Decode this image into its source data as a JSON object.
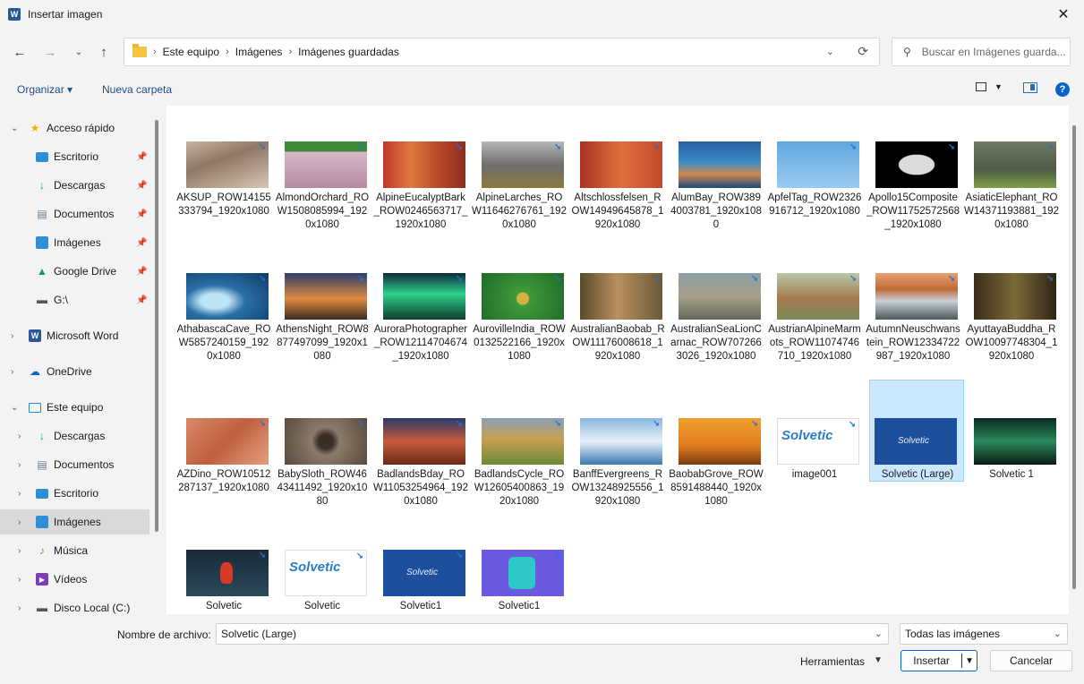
{
  "window": {
    "title": "Insertar imagen",
    "app_icon": "W"
  },
  "address": {
    "crumbs": [
      "Este equipo",
      "Imágenes",
      "Imágenes guardadas"
    ],
    "search_placeholder": "Buscar en Imágenes guarda..."
  },
  "toolbar": {
    "organize": "Organizar ▾",
    "new_folder": "Nueva carpeta"
  },
  "sidebar": {
    "items": [
      {
        "label": "Acceso rápido"
      },
      {
        "label": "Escritorio"
      },
      {
        "label": "Descargas"
      },
      {
        "label": "Documentos"
      },
      {
        "label": "Imágenes"
      },
      {
        "label": "Google Drive"
      },
      {
        "label": "G:\\"
      },
      {
        "label": "Microsoft Word"
      },
      {
        "label": "OneDrive"
      },
      {
        "label": "Este equipo"
      },
      {
        "label": "Descargas"
      },
      {
        "label": "Documentos"
      },
      {
        "label": "Escritorio"
      },
      {
        "label": "Imágenes"
      },
      {
        "label": "Música"
      },
      {
        "label": "Vídeos"
      },
      {
        "label": "Disco Local (C:)"
      }
    ]
  },
  "files": [
    {
      "name": "AKSUP_ROW14155333794_1920x1080"
    },
    {
      "name": "AlmondOrchard_ROW1508085994_1920x1080"
    },
    {
      "name": "AlpineEucalyptBark_ROW0246563717_1920x1080"
    },
    {
      "name": "AlpineLarches_ROW11646276761_1920x1080"
    },
    {
      "name": "Altschlossfelsen_ROW14949645878_1920x1080"
    },
    {
      "name": "AlumBay_ROW3894003781_1920x1080"
    },
    {
      "name": "ApfelTag_ROW2326916712_1920x1080"
    },
    {
      "name": "Apollo15Composite_ROW11752572568_1920x1080"
    },
    {
      "name": "AsiaticElephant_ROW14371193881_1920x1080"
    },
    {
      "name": "AthabascaCave_ROW5857240159_1920x1080"
    },
    {
      "name": "AthensNight_ROW8877497099_1920x1080"
    },
    {
      "name": "AuroraPhotographer_ROW12114704674_1920x1080"
    },
    {
      "name": "AurovilleIndia_ROW0132522166_1920x1080"
    },
    {
      "name": "AustralianBaobab_ROW11176008618_1920x1080"
    },
    {
      "name": "AustralianSeaLionCarnac_ROW7072663026_1920x1080"
    },
    {
      "name": "AustrianAlpineMarmots_ROW11074746710_1920x1080"
    },
    {
      "name": "AutumnNeuschwanstein_ROW12334722987_1920x1080"
    },
    {
      "name": "AyuttayaBuddha_ROW10097748304_1920x1080"
    },
    {
      "name": "AZDino_ROW10512287137_1920x1080"
    },
    {
      "name": "BabySloth_ROW4643411492_1920x1080"
    },
    {
      "name": "BadlandsBday_ROW11053254964_1920x1080"
    },
    {
      "name": "BadlandsCycle_ROW12605400863_1920x1080"
    },
    {
      "name": "BanffEvergreens_ROW13248925556_1920x1080"
    },
    {
      "name": "BaobabGrove_ROW8591488440_1920x1080"
    },
    {
      "name": "image001"
    },
    {
      "name": "Solvetic (Large)"
    },
    {
      "name": "Solvetic 1"
    },
    {
      "name": "Solvetic"
    },
    {
      "name": "Solvetic"
    },
    {
      "name": "Solvetic1"
    },
    {
      "name": "Solvetic1"
    }
  ],
  "bottom": {
    "filename_label": "Nombre de archivo:",
    "filename_value": "Solvetic (Large)",
    "filetype": "Todas las imágenes",
    "tools": "Herramientas",
    "insert": "Insertar",
    "cancel": "Cancelar"
  },
  "colors": {
    "accent": "#0067c0",
    "selection": "#cce8ff"
  }
}
